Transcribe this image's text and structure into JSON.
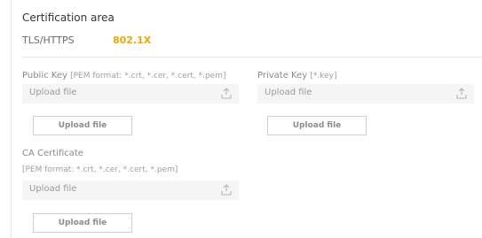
{
  "section": {
    "title": "Certification area",
    "tabs": [
      {
        "label": "TLS/HTTPS",
        "active": false
      },
      {
        "label": "802.1X",
        "active": true
      }
    ]
  },
  "public_key": {
    "label": "Public Key",
    "hint": "[PEM format: *.crt, *.cer, *.cert, *.pem]",
    "placeholder": "Upload file",
    "button": "Upload file"
  },
  "private_key": {
    "label": "Private Key",
    "hint": "[*.key]",
    "placeholder": "Upload file",
    "button": "Upload file"
  },
  "ca_certificate": {
    "label": "CA Certificate",
    "hint": "[PEM format: *.crt, *.cer, *.cert, *.pem]",
    "placeholder": "Upload file",
    "button": "Upload file"
  },
  "colors": {
    "accent": "#f0a800",
    "field_bg": "#f5f5f5",
    "border": "#cfcfcf"
  },
  "icons": {
    "upload": "upload-icon"
  }
}
